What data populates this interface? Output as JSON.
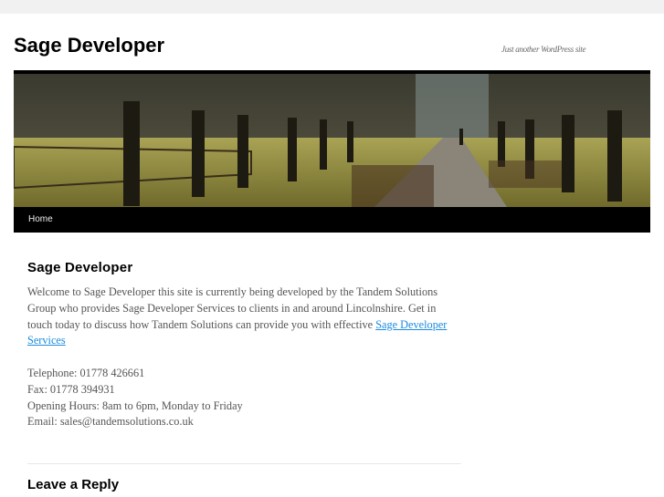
{
  "site": {
    "title": "Sage Developer",
    "tagline": "Just another WordPress site"
  },
  "nav": {
    "items": [
      {
        "label": "Home"
      }
    ]
  },
  "post": {
    "title": "Sage Developer",
    "intro": "Welcome to Sage Developer this site is currently being developed by the Tandem Solutions Group who provides Sage Developer Services to clients in and around Lincolnshire. Get in touch today to discuss how Tandem Solutions can provide you with effective ",
    "link": "Sage Developer Services",
    "telephone": "Telephone: 01778 426661",
    "fax": "Fax: 01778 394931",
    "hours": "Opening Hours: 8am to 6pm, Monday to Friday",
    "email": "Email: sales@tandemsolutions.co.uk"
  },
  "comments": {
    "heading": "Leave a Reply"
  }
}
